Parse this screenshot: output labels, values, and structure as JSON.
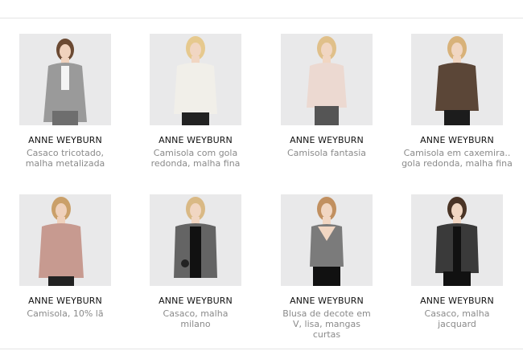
{
  "products": [
    {
      "brand": "ANNE WEYBURN",
      "title": "Casaco tricotado, malha metalizada",
      "image": "model-grey-cardigan"
    },
    {
      "brand": "ANNE WEYBURN",
      "title": "Camisola com gola redonda, malha fina",
      "image": "model-white-sweater"
    },
    {
      "brand": "ANNE WEYBURN",
      "title": "Camisola fantasia",
      "image": "model-pink-sweater"
    },
    {
      "brand": "ANNE WEYBURN",
      "title": "Camisola em caxemira.. gola redonda, malha fina",
      "image": "model-brown-sweater"
    },
    {
      "brand": "ANNE WEYBURN",
      "title": "Camisola, 10% lã",
      "image": "model-rose-sweater"
    },
    {
      "brand": "ANNE WEYBURN",
      "title": "Casaco, malha milano",
      "image": "model-grey-jacket"
    },
    {
      "brand": "ANNE WEYBURN",
      "title": "Blusa de decote em V, lisa, mangas curtas",
      "image": "model-metallic-blouse"
    },
    {
      "brand": "ANNE WEYBURN",
      "title": "Casaco, malha jacquard",
      "image": "model-jacquard-jacket"
    }
  ],
  "colors": {
    "garments": [
      "#9a9a9a",
      "#f1efe9",
      "#ecd9d1",
      "#5b4637",
      "#c79a90",
      "#646464",
      "#7b7b7b",
      "#3a3a3a"
    ],
    "hair": [
      "#6b4a33",
      "#e6c98e",
      "#e0c08a",
      "#d8b27a",
      "#caa06a",
      "#d9b985",
      "#c19060",
      "#4a3426"
    ]
  }
}
